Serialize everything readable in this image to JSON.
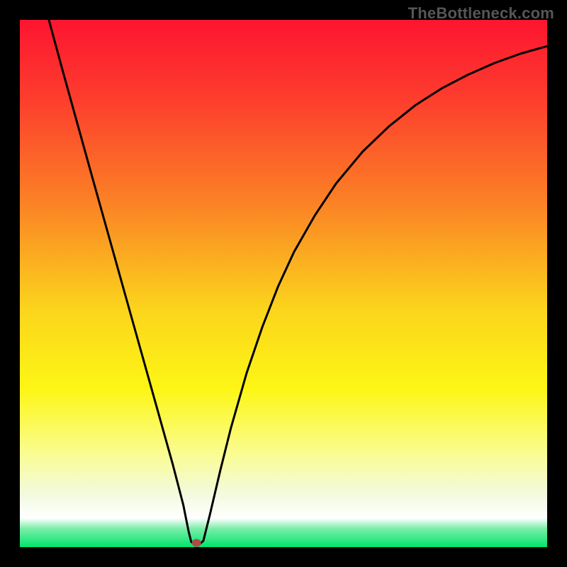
{
  "watermark": "TheBottleneck.com",
  "chart_data": {
    "type": "line",
    "title": "",
    "xlabel": "",
    "ylabel": "",
    "xlim": [
      0,
      1
    ],
    "ylim": [
      0,
      1
    ],
    "background_gradient": {
      "stops": [
        {
          "offset": 0.0,
          "color": "#fd1530"
        },
        {
          "offset": 0.15,
          "color": "#fd3d2d"
        },
        {
          "offset": 0.35,
          "color": "#fb8325"
        },
        {
          "offset": 0.55,
          "color": "#fbd51c"
        },
        {
          "offset": 0.7,
          "color": "#fdf615"
        },
        {
          "offset": 0.82,
          "color": "#fafc8f"
        },
        {
          "offset": 0.9,
          "color": "#f2fadf"
        },
        {
          "offset": 0.945,
          "color": "#ffffff"
        },
        {
          "offset": 0.965,
          "color": "#7aeea8"
        },
        {
          "offset": 1.0,
          "color": "#00e46b"
        }
      ]
    },
    "marker": {
      "x": 0.335,
      "y": 0.008,
      "color": "#b04a4a"
    },
    "curve_points": [
      {
        "x": 0.055,
        "y": 1.0
      },
      {
        "x": 0.08,
        "y": 0.908
      },
      {
        "x": 0.11,
        "y": 0.8
      },
      {
        "x": 0.14,
        "y": 0.692
      },
      {
        "x": 0.17,
        "y": 0.585
      },
      {
        "x": 0.2,
        "y": 0.478
      },
      {
        "x": 0.23,
        "y": 0.371
      },
      {
        "x": 0.26,
        "y": 0.264
      },
      {
        "x": 0.29,
        "y": 0.157
      },
      {
        "x": 0.31,
        "y": 0.08
      },
      {
        "x": 0.32,
        "y": 0.03
      },
      {
        "x": 0.325,
        "y": 0.01
      },
      {
        "x": 0.333,
        "y": 0.005
      },
      {
        "x": 0.34,
        "y": 0.005
      },
      {
        "x": 0.348,
        "y": 0.012
      },
      {
        "x": 0.36,
        "y": 0.06
      },
      {
        "x": 0.38,
        "y": 0.145
      },
      {
        "x": 0.4,
        "y": 0.225
      },
      {
        "x": 0.43,
        "y": 0.33
      },
      {
        "x": 0.46,
        "y": 0.418
      },
      {
        "x": 0.49,
        "y": 0.495
      },
      {
        "x": 0.52,
        "y": 0.56
      },
      {
        "x": 0.56,
        "y": 0.63
      },
      {
        "x": 0.6,
        "y": 0.69
      },
      {
        "x": 0.65,
        "y": 0.75
      },
      {
        "x": 0.7,
        "y": 0.798
      },
      {
        "x": 0.75,
        "y": 0.838
      },
      {
        "x": 0.8,
        "y": 0.87
      },
      {
        "x": 0.85,
        "y": 0.896
      },
      {
        "x": 0.9,
        "y": 0.918
      },
      {
        "x": 0.95,
        "y": 0.936
      },
      {
        "x": 1.0,
        "y": 0.95
      }
    ]
  }
}
